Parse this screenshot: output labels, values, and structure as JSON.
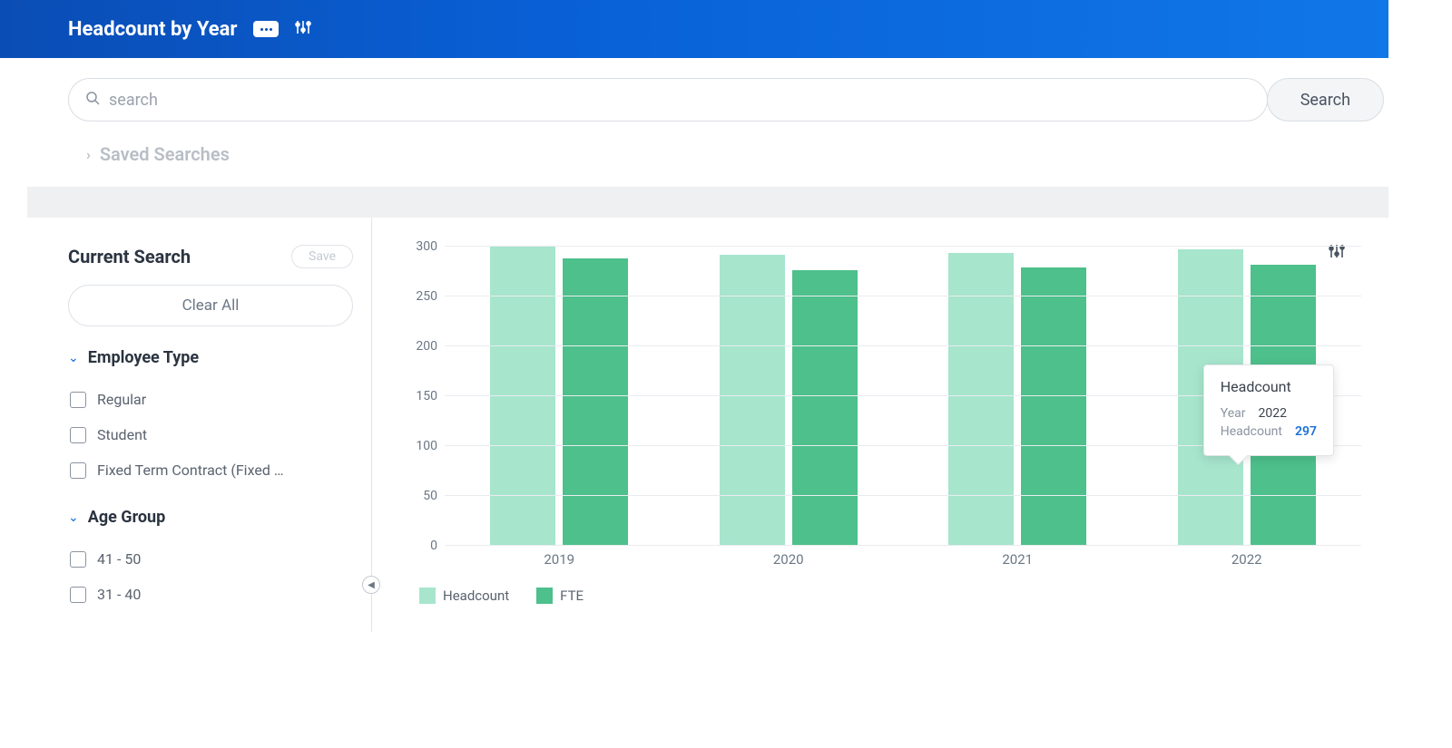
{
  "header": {
    "title": "Headcount by Year"
  },
  "search": {
    "placeholder": "search",
    "button": "Search"
  },
  "saved_searches_label": "Saved Searches",
  "sidebar": {
    "title": "Current Search",
    "save": "Save",
    "clear": "Clear All",
    "groups": [
      {
        "title": "Employee Type",
        "items": [
          {
            "label": "Regular"
          },
          {
            "label": "Student"
          },
          {
            "label": "Fixed Term Contract (Fixed …"
          }
        ]
      },
      {
        "title": "Age Group",
        "items": [
          {
            "label": "41 - 50"
          },
          {
            "label": "31 - 40"
          }
        ]
      }
    ]
  },
  "tooltip": {
    "title": "Headcount",
    "year_key": "Year",
    "year_val": "2022",
    "hc_key": "Headcount",
    "hc_val": "297"
  },
  "legend": {
    "hc": "Headcount",
    "fte": "FTE"
  },
  "chart_data": {
    "type": "bar",
    "title": "Headcount by Year",
    "xlabel": "",
    "ylabel": "",
    "ylim": [
      0,
      300
    ],
    "yticks": [
      0,
      50,
      100,
      150,
      200,
      250,
      300
    ],
    "categories": [
      "2019",
      "2020",
      "2021",
      "2022"
    ],
    "series": [
      {
        "name": "Headcount",
        "values": [
          300,
          292,
          294,
          297
        ],
        "color": "#a7e5cd"
      },
      {
        "name": "FTE",
        "values": [
          288,
          276,
          279,
          282
        ],
        "color": "#4dc08b"
      }
    ],
    "legend_position": "bottom-left",
    "grid": true
  }
}
